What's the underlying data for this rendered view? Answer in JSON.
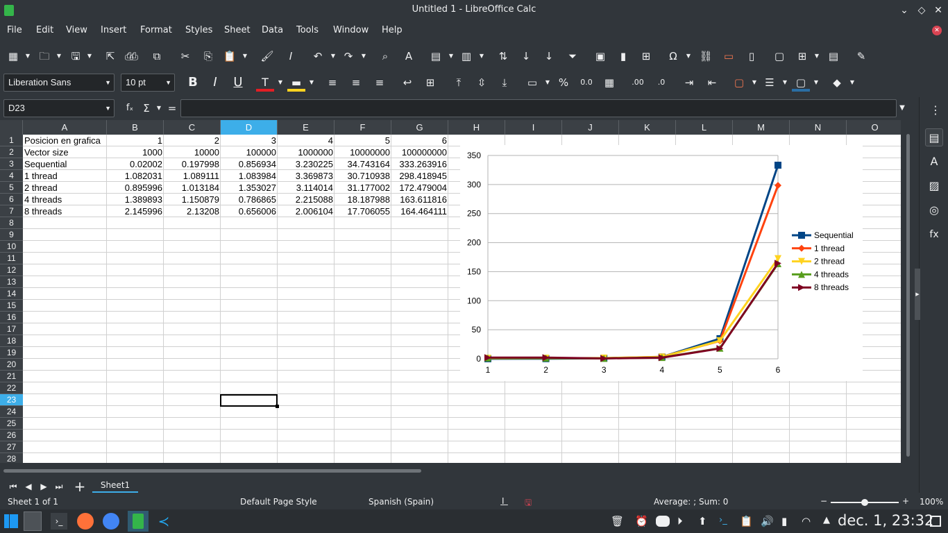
{
  "window": {
    "title": "Untitled 1 - LibreOffice Calc"
  },
  "menu": [
    "File",
    "Edit",
    "View",
    "Insert",
    "Format",
    "Styles",
    "Sheet",
    "Data",
    "Tools",
    "Window",
    "Help"
  ],
  "formatting": {
    "font_name": "Liberation Sans",
    "font_size": "10 pt"
  },
  "formula_bar": {
    "cell_ref": "D23",
    "fx": "fₓ",
    "sum": "Σ",
    "equals": "=",
    "content": ""
  },
  "columns": [
    "A",
    "B",
    "C",
    "D",
    "E",
    "F",
    "G",
    "H",
    "I",
    "J",
    "K",
    "L",
    "M",
    "N",
    "O"
  ],
  "selected_column": "D",
  "rows": [
    "1",
    "2",
    "3",
    "4",
    "5",
    "6",
    "7",
    "8",
    "9",
    "10",
    "11",
    "12",
    "13",
    "14",
    "15",
    "16",
    "17",
    "18",
    "19",
    "20",
    "21",
    "22",
    "23",
    "24",
    "25",
    "26",
    "27",
    "28"
  ],
  "selected_row": "23",
  "sheet": {
    "rows": [
      [
        "Posicion en grafica",
        "1",
        "2",
        "3",
        "4",
        "5",
        "6"
      ],
      [
        "Vector size",
        "1000",
        "10000",
        "100000",
        "1000000",
        "10000000",
        "100000000"
      ],
      [
        "Sequential",
        "0.02002",
        "0.197998",
        "0.856934",
        "3.230225",
        "34.743164",
        "333.263916"
      ],
      [
        "1 thread",
        "1.082031",
        "1.089111",
        "1.083984",
        "3.369873",
        "30.710938",
        "298.418945"
      ],
      [
        "2 thread",
        "0.895996",
        "1.013184",
        "1.353027",
        "3.114014",
        "31.177002",
        "172.479004"
      ],
      [
        "4 threads",
        "1.389893",
        "1.150879",
        "0.786865",
        "2.215088",
        "18.187988",
        "163.611816"
      ],
      [
        "8 threads",
        "2.145996",
        "2.13208",
        "0.656006",
        "2.006104",
        "17.706055",
        "164.464111"
      ]
    ]
  },
  "chart_data": {
    "type": "line",
    "x": [
      1,
      2,
      3,
      4,
      5,
      6
    ],
    "ylim": [
      0,
      350
    ],
    "yticks": [
      0,
      50,
      100,
      150,
      200,
      250,
      300,
      350
    ],
    "grid": true,
    "legend": "right",
    "series": [
      {
        "name": "Sequential",
        "color": "#004586",
        "marker": "square",
        "values": [
          0.02002,
          0.197998,
          0.856934,
          3.230225,
          34.743164,
          333.263916
        ]
      },
      {
        "name": "1 thread",
        "color": "#ff420e",
        "marker": "diamond",
        "values": [
          1.082031,
          1.089111,
          1.083984,
          3.369873,
          30.710938,
          298.418945
        ]
      },
      {
        "name": "2 thread",
        "color": "#ffd320",
        "marker": "triangle-down",
        "values": [
          0.895996,
          1.013184,
          1.353027,
          3.114014,
          31.177002,
          172.479004
        ]
      },
      {
        "name": "4 threads",
        "color": "#579d1c",
        "marker": "triangle-up",
        "values": [
          1.389893,
          1.150879,
          0.786865,
          2.215088,
          18.187988,
          163.611816
        ]
      },
      {
        "name": "8 threads",
        "color": "#7e0021",
        "marker": "triangle-right",
        "values": [
          2.145996,
          2.13208,
          0.656006,
          2.006104,
          17.706055,
          164.464111
        ]
      }
    ]
  },
  "tabs": {
    "active": "Sheet1"
  },
  "status": {
    "sheet": "Sheet 1 of 1",
    "page_style": "Default Page Style",
    "language": "Spanish (Spain)",
    "summary": "Average: ; Sum: 0",
    "zoom": "100%",
    "zoom_minus": "−",
    "zoom_plus": "+"
  },
  "taskbar": {
    "clock": "dec. 1, 23:32"
  }
}
